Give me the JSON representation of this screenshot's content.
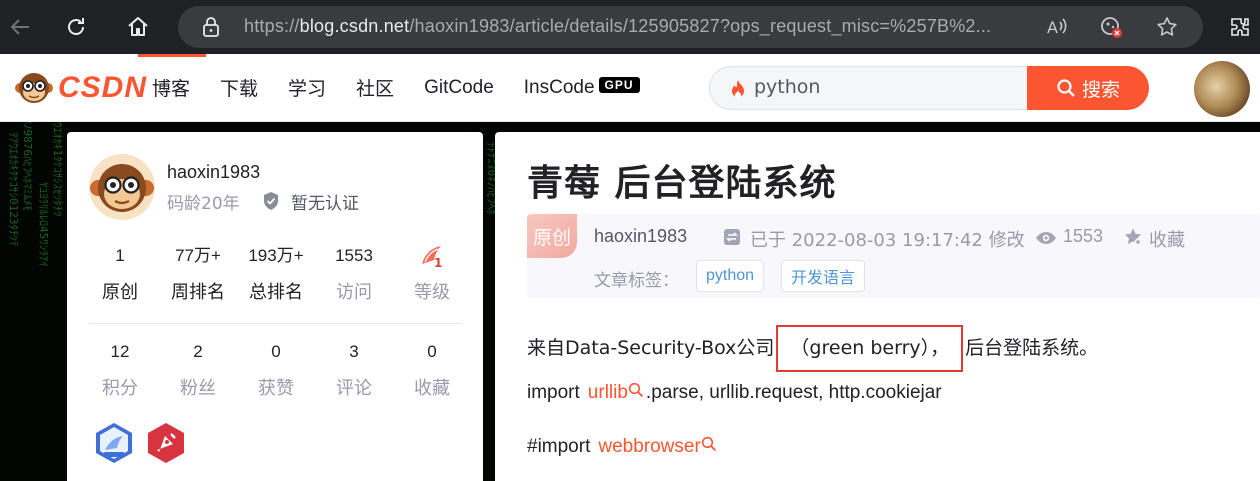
{
  "browser": {
    "url_prefix": "https://",
    "url_host": "blog.csdn.net",
    "url_path": "/haoxin1983/article/details/125905827?ops_request_misc=%257B%2..."
  },
  "toolbar": {
    "logo_text": "CSDN",
    "nav": [
      "博客",
      "下载",
      "学习",
      "社区",
      "GitCode",
      "InsCode"
    ],
    "gpu_badge": "GPU",
    "search_value": "python",
    "search_button": "搜索"
  },
  "profile": {
    "username": "haoxin1983",
    "code_age": "码龄20年",
    "cert": "暂无认证",
    "stats_row1": [
      {
        "num": "1",
        "label": "原创"
      },
      {
        "num": "77万+",
        "label": "周排名"
      },
      {
        "num": "193万+",
        "label": "总排名"
      },
      {
        "num": "1553",
        "label": "访问"
      },
      {
        "num": "",
        "label": "等级"
      }
    ],
    "stats_row2": [
      {
        "num": "12",
        "label": "积分"
      },
      {
        "num": "2",
        "label": "粉丝"
      },
      {
        "num": "0",
        "label": "获赞"
      },
      {
        "num": "3",
        "label": "评论"
      },
      {
        "num": "0",
        "label": "收藏"
      }
    ]
  },
  "article": {
    "title": "青莓 后台登陆系统",
    "original_tag": "原创",
    "author": "haoxin1983",
    "date": "已于 2022-08-03 19:17:42 修改",
    "views": "1553",
    "favorite": "收藏",
    "tags_label": "文章标签：",
    "tags": [
      "python",
      "开发语言"
    ],
    "p1_before": "来自Data-Security-Box公司",
    "p1_highlight": "（green berry），",
    "p1_after": "后台登陆系统。",
    "p2_before": "import",
    "p2_keyword": "urllib",
    "p2_after": ".parse, urllib.request, http.cookiejar",
    "p3_before": "#import",
    "p3_keyword": "webbrowser"
  },
  "colors": {
    "brand": "#fc5531",
    "highlight_border": "#e53935",
    "tag_text": "#5094d5"
  }
}
